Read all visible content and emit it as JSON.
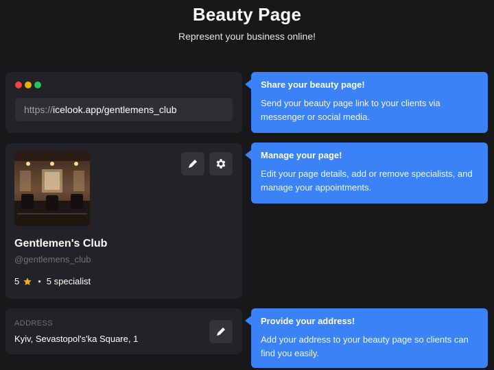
{
  "header": {
    "title": "Beauty Page",
    "subtitle": "Represent your business online!"
  },
  "url_card": {
    "url_prefix": "https://",
    "url_rest": "icelook.app/gentlemens_club"
  },
  "profile": {
    "name": "Gentlemen's Club",
    "handle": "@gentlemens_club",
    "rating": "5",
    "bullet": "•",
    "specialists": "5 specialist",
    "photo_icon": "barbershop-interior-photo"
  },
  "address": {
    "label": "ADDRESS",
    "value": "Kyiv, Sevastopol's'ka Square, 1"
  },
  "tips": {
    "share": {
      "title": "Share your beauty page!",
      "body": "Send your beauty page link to your clients via messenger or social media."
    },
    "manage": {
      "title": "Manage your page!",
      "body": "Edit your page details, add or remove specialists, and manage your appointments."
    },
    "address": {
      "title": "Provide your address!",
      "body": "Add your address to your beauty page so clients can find you easily."
    }
  },
  "icons": {
    "edit": "pencil-icon",
    "settings": "gear-icon",
    "star": "star-icon"
  },
  "colors": {
    "background": "#18181b",
    "card": "#232327",
    "accent": "#3b82f6",
    "star": "#f5b014"
  }
}
